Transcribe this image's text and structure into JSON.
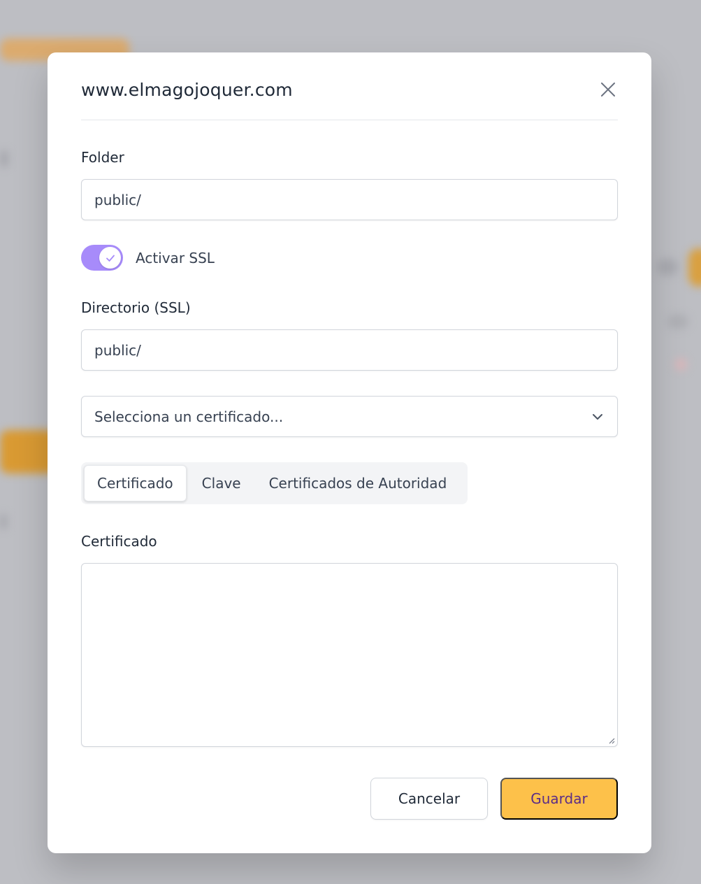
{
  "modal": {
    "title": "www.elmagojoquer.com",
    "close_icon": "close-icon"
  },
  "folder": {
    "label": "Folder",
    "value": "public/"
  },
  "ssl": {
    "label": "Activar SSL",
    "enabled": true,
    "toggle_color": "#a78bfa"
  },
  "ssl_directory": {
    "label": "Directorio (SSL)",
    "value": "public/"
  },
  "certificate_select": {
    "placeholder": "Selecciona un certificado...",
    "icon": "chevron-down-icon"
  },
  "tabs": [
    {
      "label": "Certificado",
      "active": true
    },
    {
      "label": "Clave",
      "active": false
    },
    {
      "label": "Certificados de Autoridad",
      "active": false
    }
  ],
  "certificate": {
    "label": "Certificado",
    "value": ""
  },
  "actions": {
    "cancel_label": "Cancelar",
    "save_label": "Guardar",
    "save_color": "#fdc14a"
  }
}
